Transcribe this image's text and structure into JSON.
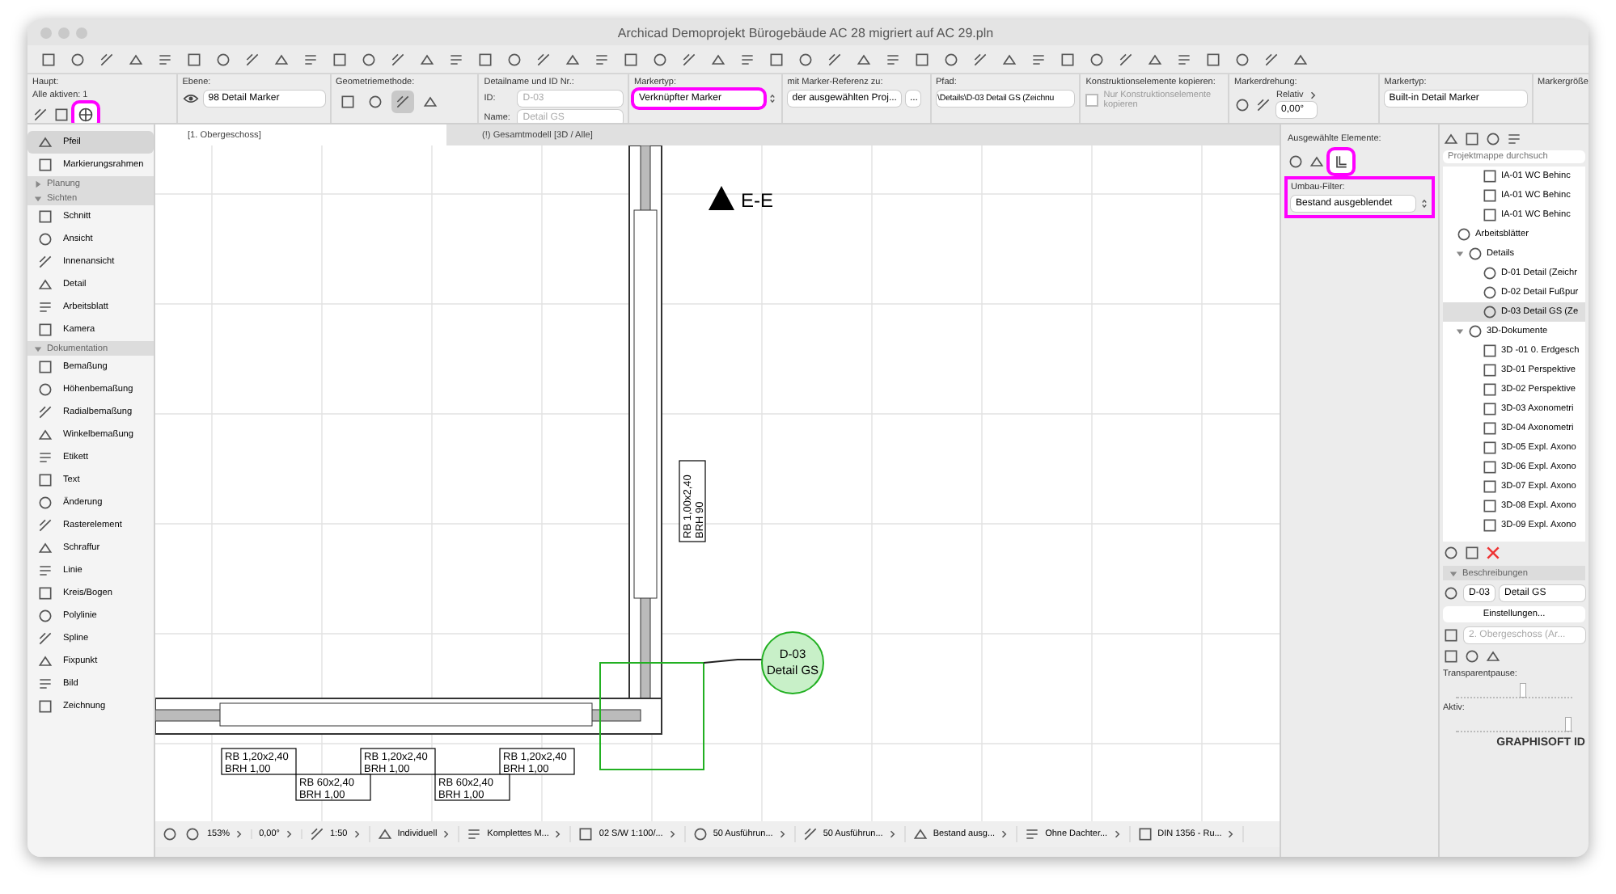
{
  "window": {
    "title": "Archicad Demoprojekt Bürogebäude AC 28 migriert auf AC 29.pln"
  },
  "info_box": {
    "haupt_label": "Haupt:",
    "alle_aktiven": "Alle aktiven: 1",
    "detail_tool_highlighted": true,
    "ebene_label": "Ebene:",
    "ebene": "98 Detail Marker",
    "geometrie_label": "Geometriemethode:",
    "geometry_methods": [
      {
        "selected": false
      },
      {
        "selected": false
      },
      {
        "selected": true
      },
      {
        "selected": false
      }
    ],
    "detailname_label": "Detailname und ID Nr.:",
    "id_label": "ID:",
    "id_value": "D-03",
    "name_label": "Name:",
    "name_value": "Detail GS",
    "markertyp_label": "Markertyp:",
    "markertyp": "Verknüpfter Marker",
    "markertyp_highlighted": true,
    "referenz_label": "mit Marker-Referenz zu:",
    "referenz": "der ausgewählten Proj...",
    "more": "...",
    "pfad_label": "Pfad:",
    "pfad": "\\Details\\D-03 Detail GS (Zeichnu",
    "kopieren_label": "Konstruktionselemente kopieren:",
    "kopieren_option": "Nur Konstruktionselemente kopieren",
    "kopieren_checked": false,
    "drehung_label": "Markerdrehung:",
    "relativ": "Relativ",
    "drehung": "0,00°",
    "markertyp2_label": "Markertyp:",
    "markertyp2": "Built-in Detail Marker",
    "groesse_label": "Markergröße"
  },
  "tabs": [
    {
      "label": "[1. Obergeschoss]",
      "selected": true
    },
    {
      "label": "(!) Gesamtmodell [3D / Alle]",
      "selected": false
    }
  ],
  "toolbox": {
    "top_items": [
      {
        "label": "Pfeil",
        "selected": true
      },
      {
        "label": "Markierungsrahmen",
        "selected": false
      }
    ],
    "groups": [
      {
        "label": "Planung",
        "expanded": false
      },
      {
        "label": "Sichten",
        "expanded": true,
        "items": [
          "Schnitt",
          "Ansicht",
          "Innenansicht",
          "Detail",
          "Arbeitsblatt",
          "Kamera"
        ]
      },
      {
        "label": "Dokumentation",
        "expanded": true,
        "items": [
          "Bemaßung",
          "Höhenbemaßung",
          "Radialbemaßung",
          "Winkelbemaßung",
          "Etikett",
          "Text",
          "Änderung",
          "Rasterelement",
          "Schraffur",
          "Linie",
          "Kreis/Bogen",
          "Polylinie",
          "Spline",
          "Fixpunkt",
          "Bild",
          "Zeichnung"
        ]
      }
    ]
  },
  "canvas": {
    "section_marker": "E-E",
    "detail_marker": {
      "id": "D-03",
      "name": "Detail GS"
    },
    "vertical_label": {
      "line1": "RB  1,00x2,40",
      "line2": "BRH  90"
    },
    "opening_labels": [
      {
        "line1": "RB    1,20x2,40",
        "line2": "BRH  1,00"
      },
      {
        "line1": "RB    1,20x2,40",
        "line2": "BRH  1,00"
      },
      {
        "line1": "RB    1,20x2,40",
        "line2": "BRH  1,00"
      },
      {
        "line1": "RB    60x2,40",
        "line2": "BRH  1,00"
      },
      {
        "line1": "RB    60x2,40",
        "line2": "BRH  1,00"
      }
    ]
  },
  "status_bar": [
    "153%",
    "0,00°",
    "1:50",
    "Individuell",
    "Komplettes M...",
    "02 S/W 1:100/...",
    "50 Ausführun...",
    "50 Ausführun...",
    "Bestand ausg...",
    "Ohne Dachter...",
    "DIN 1356 - Ru..."
  ],
  "selected_elements": {
    "label": "Ausgewählte Elemente:",
    "filter_highlighted": true,
    "umbau_label": "Umbau-Filter:",
    "umbau": "Bestand ausgeblendet",
    "umbau_highlighted": true
  },
  "navigator": {
    "search_placeholder": "Projektmappe durchsuch",
    "tree_top_children": [
      {
        "label": "IA-01 WC Behinc"
      },
      {
        "label": "IA-01 WC Behinc"
      },
      {
        "label": "IA-01 WC Behinc"
      }
    ],
    "tree": [
      {
        "label": "Arbeitsblätter",
        "selected": false
      },
      {
        "label": "Details",
        "expanded": true,
        "selected": false,
        "children": [
          {
            "label": "D-01 Detail (Zeichr",
            "selected": false
          },
          {
            "label": "D-02 Detail Fußpur",
            "selected": false
          },
          {
            "label": "D-03 Detail GS (Ze",
            "selected": true
          }
        ]
      },
      {
        "label": "3D-Dokumente",
        "expanded": true,
        "selected": false,
        "children": [
          {
            "label": "3D -01 0. Erdgesch",
            "selected": false
          },
          {
            "label": "3D-01 Perspektive",
            "selected": false
          },
          {
            "label": "3D-02 Perspektive",
            "selected": false
          },
          {
            "label": "3D-03 Axonometri",
            "selected": false
          },
          {
            "label": "3D-04 Axonometri",
            "selected": false
          },
          {
            "label": "3D-05 Expl. Axono",
            "selected": false
          },
          {
            "label": "3D-06 Expl. Axono",
            "selected": false
          },
          {
            "label": "3D-07 Expl. Axono",
            "selected": false
          },
          {
            "label": "3D-08 Expl. Axono",
            "selected": false
          },
          {
            "label": "3D-09 Expl. Axono",
            "selected": false
          }
        ]
      }
    ],
    "beschreibungen": {
      "label": "Beschreibungen",
      "expanded": true,
      "id": "D-03",
      "name": "Detail GS",
      "button": "Einstellungen...",
      "path": "2. Obergeschoss (Ar..."
    },
    "transparent_label": "Transparentpause:",
    "transparent": {
      "level": 0.55
    },
    "aktiv_label": "Aktiv:",
    "aktiv": {
      "level": 0.95
    },
    "brand": "GRAPHISOFT ID"
  }
}
